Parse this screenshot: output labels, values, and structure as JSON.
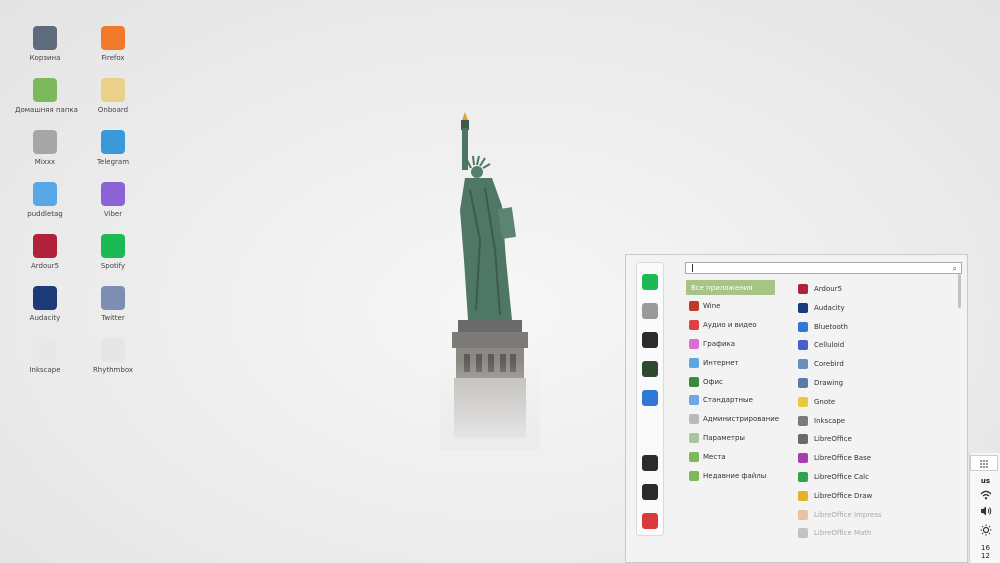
{
  "desktop": {
    "icons": [
      {
        "label": "Корзина",
        "icon": "trash-icon",
        "color": "#5d6b7c"
      },
      {
        "label": "Домашняя папка",
        "icon": "home-folder-icon",
        "color": "#7db85a"
      },
      {
        "label": "Mixxx",
        "icon": "mixxx-icon",
        "color": "#a6a6a6"
      },
      {
        "label": "puddletag",
        "icon": "puddletag-icon",
        "color": "#5aa7e6"
      },
      {
        "label": "Ardour5",
        "icon": "ardour-icon",
        "color": "#b0223a"
      },
      {
        "label": "Audacity",
        "icon": "audacity-icon",
        "color": "#1c3a7a"
      },
      {
        "label": "Inkscape",
        "icon": "inkscape-icon",
        "color": "#e8e8e8"
      },
      {
        "label": "Firefox",
        "icon": "firefox-icon",
        "color": "#f07a2a"
      },
      {
        "label": "Onboard",
        "icon": "onboard-icon",
        "color": "#e9d18a"
      },
      {
        "label": "Telegram",
        "icon": "telegram-icon",
        "color": "#3a9ad9"
      },
      {
        "label": "Viber",
        "icon": "viber-icon",
        "color": "#8b63d6"
      },
      {
        "label": "Spotify",
        "icon": "spotify-icon",
        "color": "#1db954"
      },
      {
        "label": "Twitter",
        "icon": "twitter-icon",
        "color": "#7c8fb3"
      },
      {
        "label": "Rhythmbox",
        "icon": "rhythmbox-icon",
        "color": "#e6e6e6"
      }
    ]
  },
  "menu": {
    "search_value": "",
    "favorites": [
      {
        "name": "spotify-fav",
        "icon": "spotify-icon",
        "color": "#1db954"
      },
      {
        "name": "settings-fav",
        "icon": "toggles-icon",
        "color": "#9a9a9a"
      },
      {
        "name": "terminal-fav",
        "icon": "terminal-icon",
        "color": "#2b2b2b"
      },
      {
        "name": "system-monitor-fav",
        "icon": "system-monitor-icon",
        "color": "#2e4a2e"
      },
      {
        "name": "bluetooth-fav",
        "icon": "bluetooth-icon",
        "color": "#2f78d8"
      }
    ],
    "session": [
      {
        "name": "lock-screen-button",
        "icon": "lock-icon",
        "color": "#2b2b2b"
      },
      {
        "name": "logout-button",
        "icon": "logout-icon",
        "color": "#2b2b2b"
      },
      {
        "name": "shutdown-button",
        "icon": "power-icon",
        "color": "#d83b3b"
      }
    ],
    "categories": [
      {
        "label": "Все приложения",
        "active": true,
        "color": "#a6c485"
      },
      {
        "label": "Wine",
        "color": "#c0392b"
      },
      {
        "label": "Аудио и видео",
        "color": "#e04040"
      },
      {
        "label": "Графика",
        "color": "#d96fd0"
      },
      {
        "label": "Интернет",
        "color": "#5aa7e6"
      },
      {
        "label": "Офис",
        "color": "#3a8a3a"
      },
      {
        "label": "Стандартные",
        "color": "#6aa8e8"
      },
      {
        "label": "Администрирование",
        "color": "#b9b9b9"
      },
      {
        "label": "Параметры",
        "color": "#a9c69a"
      },
      {
        "label": "Места",
        "color": "#7db85a"
      },
      {
        "label": "Недавние файлы",
        "color": "#7db85a"
      }
    ],
    "apps": [
      {
        "label": "Ardour5",
        "color": "#b0223a"
      },
      {
        "label": "Audacity",
        "color": "#1c3a7a"
      },
      {
        "label": "Bluetooth",
        "color": "#2f78d8"
      },
      {
        "label": "Celluloid",
        "color": "#4a5fc9"
      },
      {
        "label": "Corebird",
        "color": "#6a8fbf"
      },
      {
        "label": "Drawing",
        "color": "#5a7aa8"
      },
      {
        "label": "Gnote",
        "color": "#e8c93a"
      },
      {
        "label": "Inkscape",
        "color": "#7a7a7a"
      },
      {
        "label": "LibreOffice",
        "color": "#6a6a6a"
      },
      {
        "label": "LibreOffice Base",
        "color": "#a33db0"
      },
      {
        "label": "LibreOffice Calc",
        "color": "#2ea44f"
      },
      {
        "label": "LibreOffice Draw",
        "color": "#e2b32a"
      },
      {
        "label": "LibreOffice Impress",
        "color": "#e07a2a",
        "faded": true
      },
      {
        "label": "LibreOffice Math",
        "color": "#7a7a7a",
        "faded": true
      }
    ]
  },
  "tray": {
    "keyboard_layout": "us",
    "clock_hour": "16",
    "clock_minute": "12"
  }
}
